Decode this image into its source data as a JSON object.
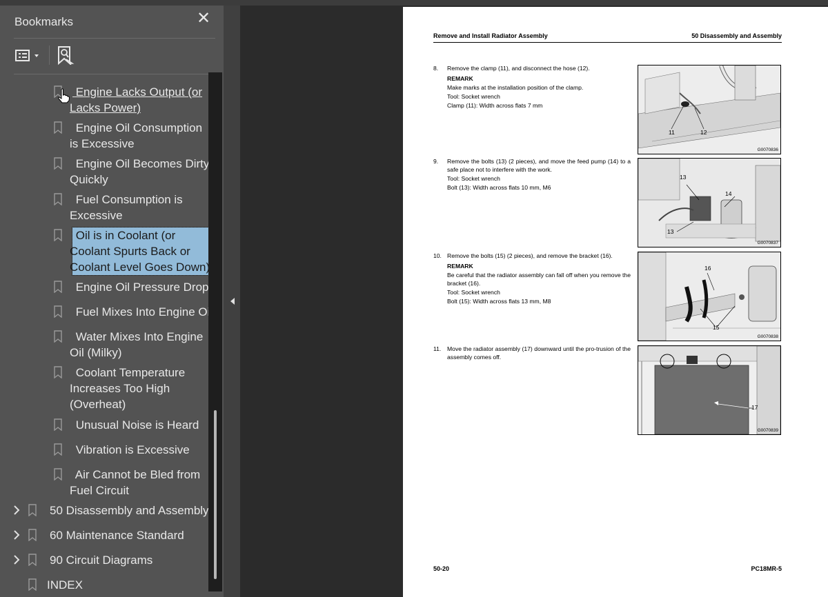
{
  "sidebar": {
    "title": "Bookmarks",
    "close_label": "✕",
    "items": [
      {
        "label_lines": [
          " Engine Lacks Output (or",
          "Lacks Power)"
        ],
        "state": "hover"
      },
      {
        "label_lines": [
          " Engine Oil Consumption",
          "is Excessive"
        ]
      },
      {
        "label_lines": [
          " Engine Oil Becomes Dirty",
          "Quickly"
        ]
      },
      {
        "label_lines": [
          " Fuel Consumption is",
          "Excessive"
        ]
      },
      {
        "label_lines": [
          " Oil is in Coolant (or",
          "Coolant Spurts Back or",
          "Coolant Level Goes Down)"
        ],
        "state": "selected"
      },
      {
        "label_lines": [
          " Engine Oil Pressure Drops"
        ]
      },
      {
        "label_lines": [
          " Fuel Mixes Into Engine Oil"
        ]
      },
      {
        "label_lines": [
          " Water Mixes Into Engine",
          "Oil (Milky)"
        ]
      },
      {
        "label_lines": [
          " Coolant Temperature",
          "Increases Too High",
          "(Overheat)"
        ]
      },
      {
        "label_lines": [
          " Unusual Noise is Heard"
        ]
      },
      {
        "label_lines": [
          " Vibration is Excessive"
        ]
      },
      {
        "label_lines": [
          " Air Cannot be Bled from",
          "Fuel Circuit"
        ]
      }
    ],
    "sections": [
      {
        "label": "50 Disassembly and Assembly",
        "expandable": true
      },
      {
        "label": "60 Maintenance Standard",
        "expandable": true
      },
      {
        "label": "90 Circuit Diagrams",
        "expandable": true
      },
      {
        "label": "INDEX",
        "expandable": false
      }
    ]
  },
  "document": {
    "header_left": "Remove and Install Radiator Assembly",
    "header_right": "50 Disassembly and Assembly",
    "steps": [
      {
        "num": "8.",
        "lines": [
          {
            "text": "Remove the clamp (11), and disconnect the hose (12).",
            "bold": false
          },
          {
            "text": "REMARK",
            "bold": true
          },
          {
            "text": "Make marks at the installation position of the clamp.",
            "bold": false
          },
          {
            "text": "Tool: Socket wrench",
            "bold": false
          },
          {
            "text": "Clamp (11): Width across flats 7 mm",
            "bold": false
          }
        ],
        "figure_code": "G0070836",
        "callouts": [
          "11",
          "12"
        ]
      },
      {
        "num": "9.",
        "lines": [
          {
            "text": "Remove the bolts (13) (2 pieces), and move the feed pump (14) to a safe place not to interfere with the work.",
            "bold": false
          },
          {
            "text": "Tool: Socket wrench",
            "bold": false
          },
          {
            "text": "Bolt (13): Width across flats 10 mm, M6",
            "bold": false
          }
        ],
        "figure_code": "G0070837",
        "callouts": [
          "13",
          "14",
          "13"
        ]
      },
      {
        "num": "10.",
        "lines": [
          {
            "text": "Remove the bolts (15) (2 pieces), and remove the bracket (16).",
            "bold": false
          },
          {
            "text": "REMARK",
            "bold": true
          },
          {
            "text": "Be careful that the radiator assembly can fall off when you remove the bracket (16).",
            "bold": false
          },
          {
            "text": "Tool: Socket wrench",
            "bold": false
          },
          {
            "text": "Bolt (15): Width across flats 13 mm, M8",
            "bold": false
          }
        ],
        "figure_code": "G0070838",
        "callouts": [
          "16",
          "15"
        ]
      },
      {
        "num": "11.",
        "lines": [
          {
            "text": "Move the radiator assembly (17) downward until the pro-trusion of the assembly comes off.",
            "bold": false
          }
        ],
        "figure_code": "G0070839",
        "callouts": [
          "17"
        ]
      }
    ],
    "footer_left": "50-20",
    "footer_right": "PC18MR-5"
  }
}
